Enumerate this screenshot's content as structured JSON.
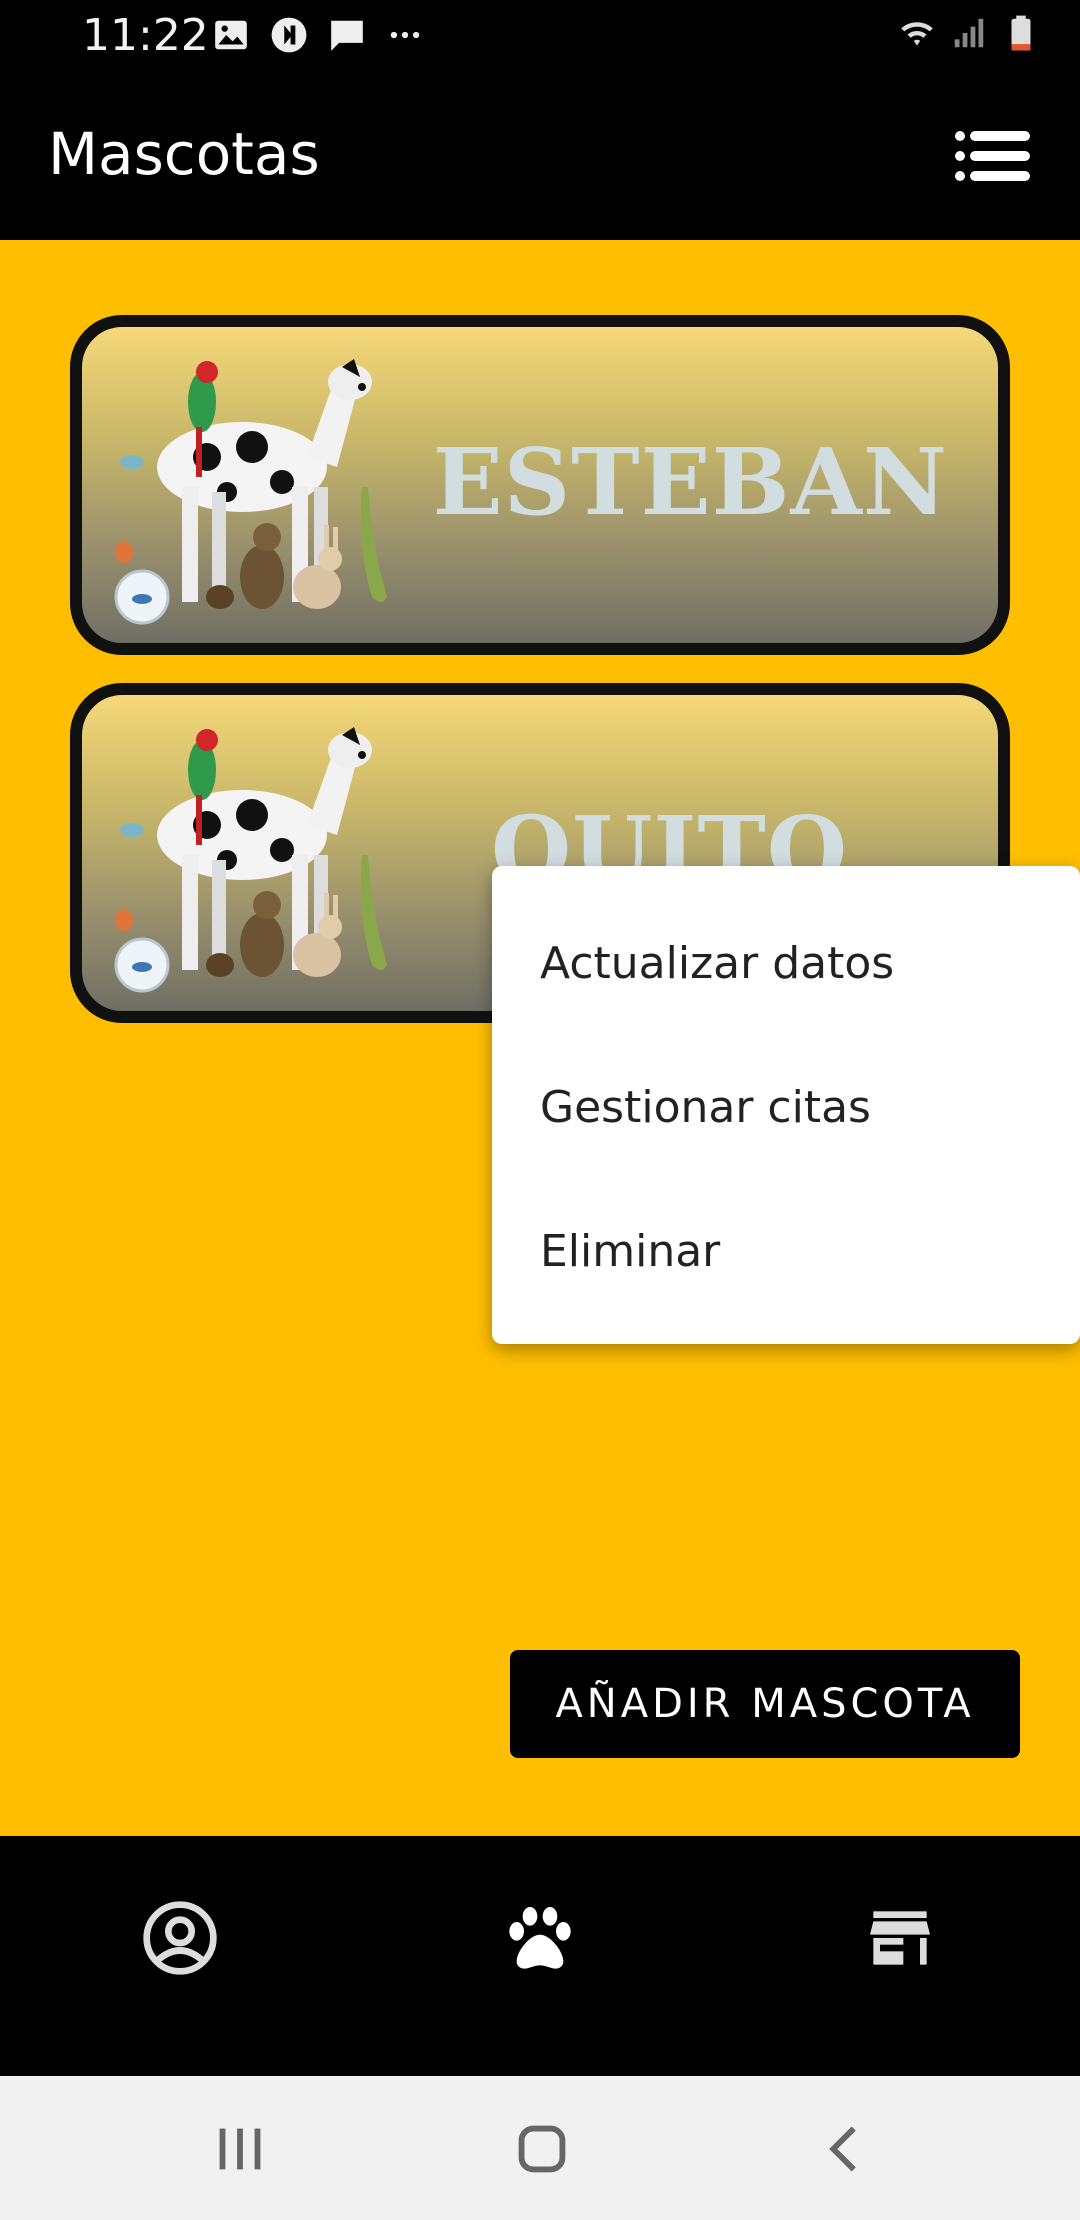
{
  "status_bar": {
    "time": "11:22",
    "icons": [
      "image-icon",
      "recycle-icon",
      "message-icon",
      "more-icon",
      "wifi-icon",
      "signal-icon",
      "battery-icon"
    ]
  },
  "app_bar": {
    "title": "Mascotas",
    "menu_icon": "list-menu-icon"
  },
  "pets": [
    {
      "name": "ESTEBAN"
    },
    {
      "name": "QUITO"
    }
  ],
  "popup_menu": {
    "items": [
      "Actualizar datos",
      "Gestionar citas",
      "Eliminar"
    ]
  },
  "add_button": {
    "label": "AÑADIR MASCOTA"
  },
  "bottom_nav": {
    "items": [
      {
        "icon": "account-circle-icon"
      },
      {
        "icon": "paw-icon"
      },
      {
        "icon": "store-icon"
      }
    ]
  },
  "system_nav": {
    "items": [
      {
        "icon": "recents-icon"
      },
      {
        "icon": "home-icon"
      },
      {
        "icon": "back-icon"
      }
    ]
  },
  "colors": {
    "background": "#ffbf00",
    "app_bar": "#000000",
    "card_border": "#111111",
    "pet_name": "#d2dde0"
  }
}
